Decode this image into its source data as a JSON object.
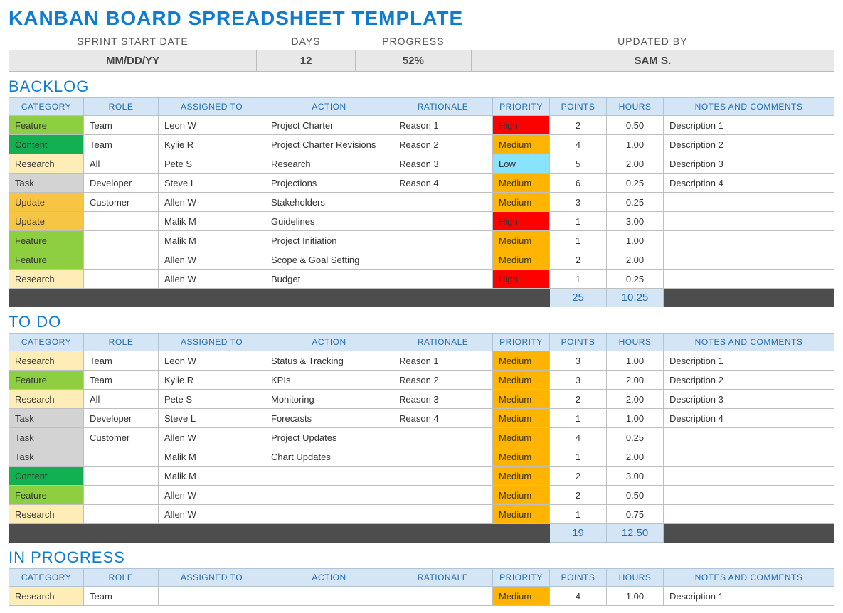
{
  "title": "KANBAN BOARD SPREADSHEET TEMPLATE",
  "meta": {
    "headers": [
      "SPRINT START DATE",
      "DAYS",
      "PROGRESS",
      "UPDATED BY"
    ],
    "values": [
      "MM/DD/YY",
      "12",
      "52%",
      "SAM S."
    ]
  },
  "columns": [
    "CATEGORY",
    "ROLE",
    "ASSIGNED TO",
    "ACTION",
    "RATIONALE",
    "PRIORITY",
    "POINTS",
    "HOURS",
    "NOTES AND COMMENTS"
  ],
  "sections": [
    {
      "title": "BACKLOG",
      "rows": [
        {
          "category": "Feature",
          "role": "Team",
          "assigned": "Leon W",
          "action": "Project Charter",
          "rationale": "Reason 1",
          "priority": "High",
          "points": "2",
          "hours": "0.50",
          "notes": "Description 1"
        },
        {
          "category": "Content",
          "role": "Team",
          "assigned": "Kylie R",
          "action": "Project Charter Revisions",
          "rationale": "Reason 2",
          "priority": "Medium",
          "points": "4",
          "hours": "1.00",
          "notes": "Description 2"
        },
        {
          "category": "Research",
          "role": "All",
          "assigned": "Pete S",
          "action": "Research",
          "rationale": "Reason 3",
          "priority": "Low",
          "points": "5",
          "hours": "2.00",
          "notes": "Description 3"
        },
        {
          "category": "Task",
          "role": "Developer",
          "assigned": "Steve L",
          "action": "Projections",
          "rationale": "Reason 4",
          "priority": "Medium",
          "points": "6",
          "hours": "0.25",
          "notes": "Description 4"
        },
        {
          "category": "Update",
          "role": "Customer",
          "assigned": "Allen W",
          "action": "Stakeholders",
          "rationale": "",
          "priority": "Medium",
          "points": "3",
          "hours": "0.25",
          "notes": ""
        },
        {
          "category": "Update",
          "role": "",
          "assigned": "Malik M",
          "action": "Guidelines",
          "rationale": "",
          "priority": "High",
          "points": "1",
          "hours": "3.00",
          "notes": ""
        },
        {
          "category": "Feature",
          "role": "",
          "assigned": "Malik M",
          "action": "Project Initiation",
          "rationale": "",
          "priority": "Medium",
          "points": "1",
          "hours": "1.00",
          "notes": ""
        },
        {
          "category": "Feature",
          "role": "",
          "assigned": "Allen W",
          "action": "Scope & Goal Setting",
          "rationale": "",
          "priority": "Medium",
          "points": "2",
          "hours": "2.00",
          "notes": ""
        },
        {
          "category": "Research",
          "role": "",
          "assigned": "Allen W",
          "action": "Budget",
          "rationale": "",
          "priority": "High",
          "points": "1",
          "hours": "0.25",
          "notes": ""
        }
      ],
      "totals": {
        "points": "25",
        "hours": "10.25"
      }
    },
    {
      "title": "TO DO",
      "rows": [
        {
          "category": "Research",
          "role": "Team",
          "assigned": "Leon W",
          "action": "Status & Tracking",
          "rationale": "Reason 1",
          "priority": "Medium",
          "points": "3",
          "hours": "1.00",
          "notes": "Description 1"
        },
        {
          "category": "Feature",
          "role": "Team",
          "assigned": "Kylie R",
          "action": "KPIs",
          "rationale": "Reason 2",
          "priority": "Medium",
          "points": "3",
          "hours": "2.00",
          "notes": "Description 2"
        },
        {
          "category": "Research",
          "role": "All",
          "assigned": "Pete S",
          "action": "Monitoring",
          "rationale": "Reason 3",
          "priority": "Medium",
          "points": "2",
          "hours": "2.00",
          "notes": "Description 3"
        },
        {
          "category": "Task",
          "role": "Developer",
          "assigned": "Steve L",
          "action": "Forecasts",
          "rationale": "Reason 4",
          "priority": "Medium",
          "points": "1",
          "hours": "1.00",
          "notes": "Description 4"
        },
        {
          "category": "Task",
          "role": "Customer",
          "assigned": "Allen W",
          "action": "Project Updates",
          "rationale": "",
          "priority": "Medium",
          "points": "4",
          "hours": "0.25",
          "notes": ""
        },
        {
          "category": "Task",
          "role": "",
          "assigned": "Malik M",
          "action": "Chart Updates",
          "rationale": "",
          "priority": "Medium",
          "points": "1",
          "hours": "2.00",
          "notes": ""
        },
        {
          "category": "Content",
          "role": "",
          "assigned": "Malik M",
          "action": "",
          "rationale": "",
          "priority": "Medium",
          "points": "2",
          "hours": "3.00",
          "notes": ""
        },
        {
          "category": "Feature",
          "role": "",
          "assigned": "Allen W",
          "action": "",
          "rationale": "",
          "priority": "Medium",
          "points": "2",
          "hours": "0.50",
          "notes": ""
        },
        {
          "category": "Research",
          "role": "",
          "assigned": "Allen W",
          "action": "",
          "rationale": "",
          "priority": "Medium",
          "points": "1",
          "hours": "0.75",
          "notes": ""
        }
      ],
      "totals": {
        "points": "19",
        "hours": "12.50"
      }
    },
    {
      "title": "IN PROGRESS",
      "rows": [
        {
          "category": "Research",
          "role": "Team",
          "assigned": "",
          "action": "",
          "rationale": "",
          "priority": "Medium",
          "points": "4",
          "hours": "1.00",
          "notes": "Description 1"
        }
      ],
      "totals": null
    }
  ]
}
